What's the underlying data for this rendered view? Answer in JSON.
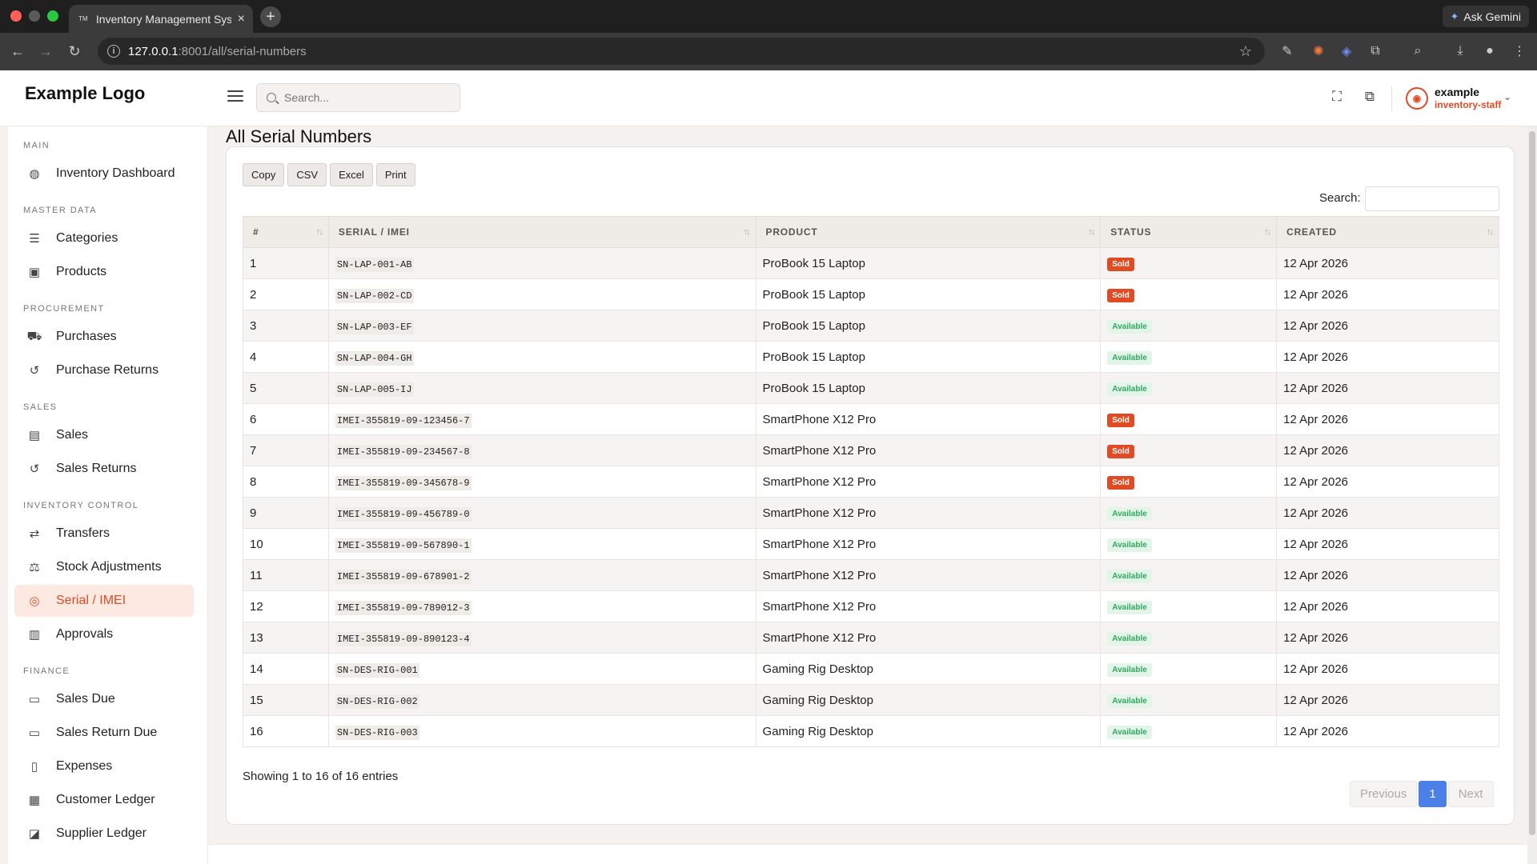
{
  "browser": {
    "tab_title": "Inventory Management System",
    "tab_favicon": "TM",
    "url_host": "127.0.0.1",
    "url_path": ":8001/all/serial-numbers",
    "gemini_label": "Ask Gemini"
  },
  "header": {
    "logo": "Example Logo",
    "search_placeholder": "Search...",
    "user_name": "example",
    "user_role": "inventory-staff"
  },
  "sidebar": {
    "sections": [
      {
        "label": "MAIN"
      },
      {
        "label": "MASTER DATA"
      },
      {
        "label": "PROCUREMENT"
      },
      {
        "label": "SALES"
      },
      {
        "label": "INVENTORY CONTROL"
      },
      {
        "label": "FINANCE"
      }
    ],
    "items": [
      {
        "label": "Inventory Dashboard",
        "icon": "dashboard-icon"
      },
      {
        "label": "Categories",
        "icon": "list-icon"
      },
      {
        "label": "Products",
        "icon": "box-icon"
      },
      {
        "label": "Purchases",
        "icon": "cart-icon"
      },
      {
        "label": "Purchase Returns",
        "icon": "undo-icon"
      },
      {
        "label": "Sales",
        "icon": "receipt-icon"
      },
      {
        "label": "Sales Returns",
        "icon": "undo-icon"
      },
      {
        "label": "Transfers",
        "icon": "transfer-icon"
      },
      {
        "label": "Stock Adjustments",
        "icon": "scale-icon"
      },
      {
        "label": "Serial / IMEI",
        "icon": "fingerprint-icon",
        "active": true
      },
      {
        "label": "Approvals",
        "icon": "clipboard-check-icon"
      },
      {
        "label": "Sales Due",
        "icon": "money-icon"
      },
      {
        "label": "Sales Return Due",
        "icon": "money-icon"
      },
      {
        "label": "Expenses",
        "icon": "invoice-icon"
      },
      {
        "label": "Customer Ledger",
        "icon": "book-icon"
      },
      {
        "label": "Supplier Ledger",
        "icon": "supplier-icon"
      }
    ]
  },
  "main": {
    "title": "All Serial Numbers",
    "buttons": {
      "copy": "Copy",
      "csv": "CSV",
      "excel": "Excel",
      "print": "Print"
    },
    "search_label": "Search:",
    "columns": [
      "#",
      "SERIAL / IMEI",
      "PRODUCT",
      "STATUS",
      "CREATED"
    ],
    "rows": [
      {
        "n": "1",
        "serial": "SN-LAP-001-AB",
        "product": "ProBook 15 Laptop",
        "status": "Sold",
        "created": "12 Apr 2026"
      },
      {
        "n": "2",
        "serial": "SN-LAP-002-CD",
        "product": "ProBook 15 Laptop",
        "status": "Sold",
        "created": "12 Apr 2026"
      },
      {
        "n": "3",
        "serial": "SN-LAP-003-EF",
        "product": "ProBook 15 Laptop",
        "status": "Available",
        "created": "12 Apr 2026"
      },
      {
        "n": "4",
        "serial": "SN-LAP-004-GH",
        "product": "ProBook 15 Laptop",
        "status": "Available",
        "created": "12 Apr 2026"
      },
      {
        "n": "5",
        "serial": "SN-LAP-005-IJ",
        "product": "ProBook 15 Laptop",
        "status": "Available",
        "created": "12 Apr 2026"
      },
      {
        "n": "6",
        "serial": "IMEI-355819-09-123456-7",
        "product": "SmartPhone X12 Pro",
        "status": "Sold",
        "created": "12 Apr 2026"
      },
      {
        "n": "7",
        "serial": "IMEI-355819-09-234567-8",
        "product": "SmartPhone X12 Pro",
        "status": "Sold",
        "created": "12 Apr 2026"
      },
      {
        "n": "8",
        "serial": "IMEI-355819-09-345678-9",
        "product": "SmartPhone X12 Pro",
        "status": "Sold",
        "created": "12 Apr 2026"
      },
      {
        "n": "9",
        "serial": "IMEI-355819-09-456789-0",
        "product": "SmartPhone X12 Pro",
        "status": "Available",
        "created": "12 Apr 2026"
      },
      {
        "n": "10",
        "serial": "IMEI-355819-09-567890-1",
        "product": "SmartPhone X12 Pro",
        "status": "Available",
        "created": "12 Apr 2026"
      },
      {
        "n": "11",
        "serial": "IMEI-355819-09-678901-2",
        "product": "SmartPhone X12 Pro",
        "status": "Available",
        "created": "12 Apr 2026"
      },
      {
        "n": "12",
        "serial": "IMEI-355819-09-789012-3",
        "product": "SmartPhone X12 Pro",
        "status": "Available",
        "created": "12 Apr 2026"
      },
      {
        "n": "13",
        "serial": "IMEI-355819-09-890123-4",
        "product": "SmartPhone X12 Pro",
        "status": "Available",
        "created": "12 Apr 2026"
      },
      {
        "n": "14",
        "serial": "SN-DES-RIG-001",
        "product": "Gaming Rig Desktop",
        "status": "Available",
        "created": "12 Apr 2026"
      },
      {
        "n": "15",
        "serial": "SN-DES-RIG-002",
        "product": "Gaming Rig Desktop",
        "status": "Available",
        "created": "12 Apr 2026"
      },
      {
        "n": "16",
        "serial": "SN-DES-RIG-003",
        "product": "Gaming Rig Desktop",
        "status": "Available",
        "created": "12 Apr 2026"
      }
    ],
    "info": "Showing 1 to 16 of 16 entries",
    "pagination": {
      "previous": "Previous",
      "current": "1",
      "next": "Next"
    }
  },
  "colors": {
    "accent": "#e14b24",
    "sold": "#e14b24",
    "available_bg": "#e2f5e8",
    "available_text": "#31a860",
    "page_active": "#4a80e8"
  }
}
